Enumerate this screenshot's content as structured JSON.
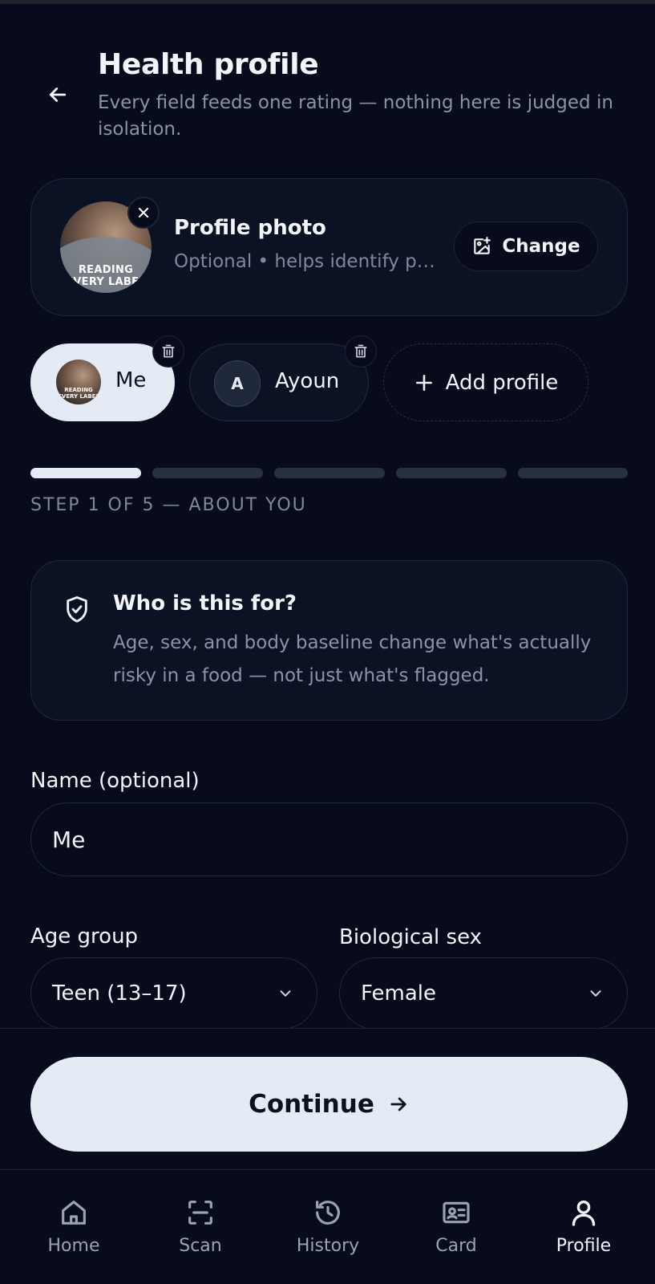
{
  "header": {
    "title": "Health profile",
    "subtitle": "Every field feeds one rating — nothing here is judged in isolation."
  },
  "photo_card": {
    "title": "Profile photo",
    "subtitle": "Optional • helps identify pr...",
    "change_label": "Change",
    "photo_text": "READING EVERY LABEL"
  },
  "profiles": {
    "items": [
      {
        "label": "Me",
        "avatar": "photo"
      },
      {
        "label": "Ayoun",
        "avatar_letter": "A"
      }
    ],
    "add_label": "Add profile"
  },
  "steps": {
    "total": 5,
    "current": 1,
    "label": "STEP 1 OF 5 — ABOUT YOU"
  },
  "info_card": {
    "title": "Who is this for?",
    "body": "Age, sex, and body baseline change what's actually risky in a food — not just what's flagged."
  },
  "form": {
    "name_label": "Name (optional)",
    "name_value": "Me",
    "age_label": "Age group",
    "age_value": "Teen (13–17)",
    "sex_label": "Biological sex",
    "sex_value": "Female"
  },
  "continue_label": "Continue",
  "nav": {
    "items": [
      {
        "label": "Home",
        "icon": "home-icon"
      },
      {
        "label": "Scan",
        "icon": "scan-icon"
      },
      {
        "label": "History",
        "icon": "history-icon"
      },
      {
        "label": "Card",
        "icon": "card-icon"
      },
      {
        "label": "Profile",
        "icon": "profile-icon",
        "active": true
      }
    ]
  },
  "colors": {
    "background": "#070b1c",
    "card": "#0b1224",
    "border": "#1f2940",
    "accent_light": "#e4ebf4",
    "muted_text": "#8b93a8"
  }
}
